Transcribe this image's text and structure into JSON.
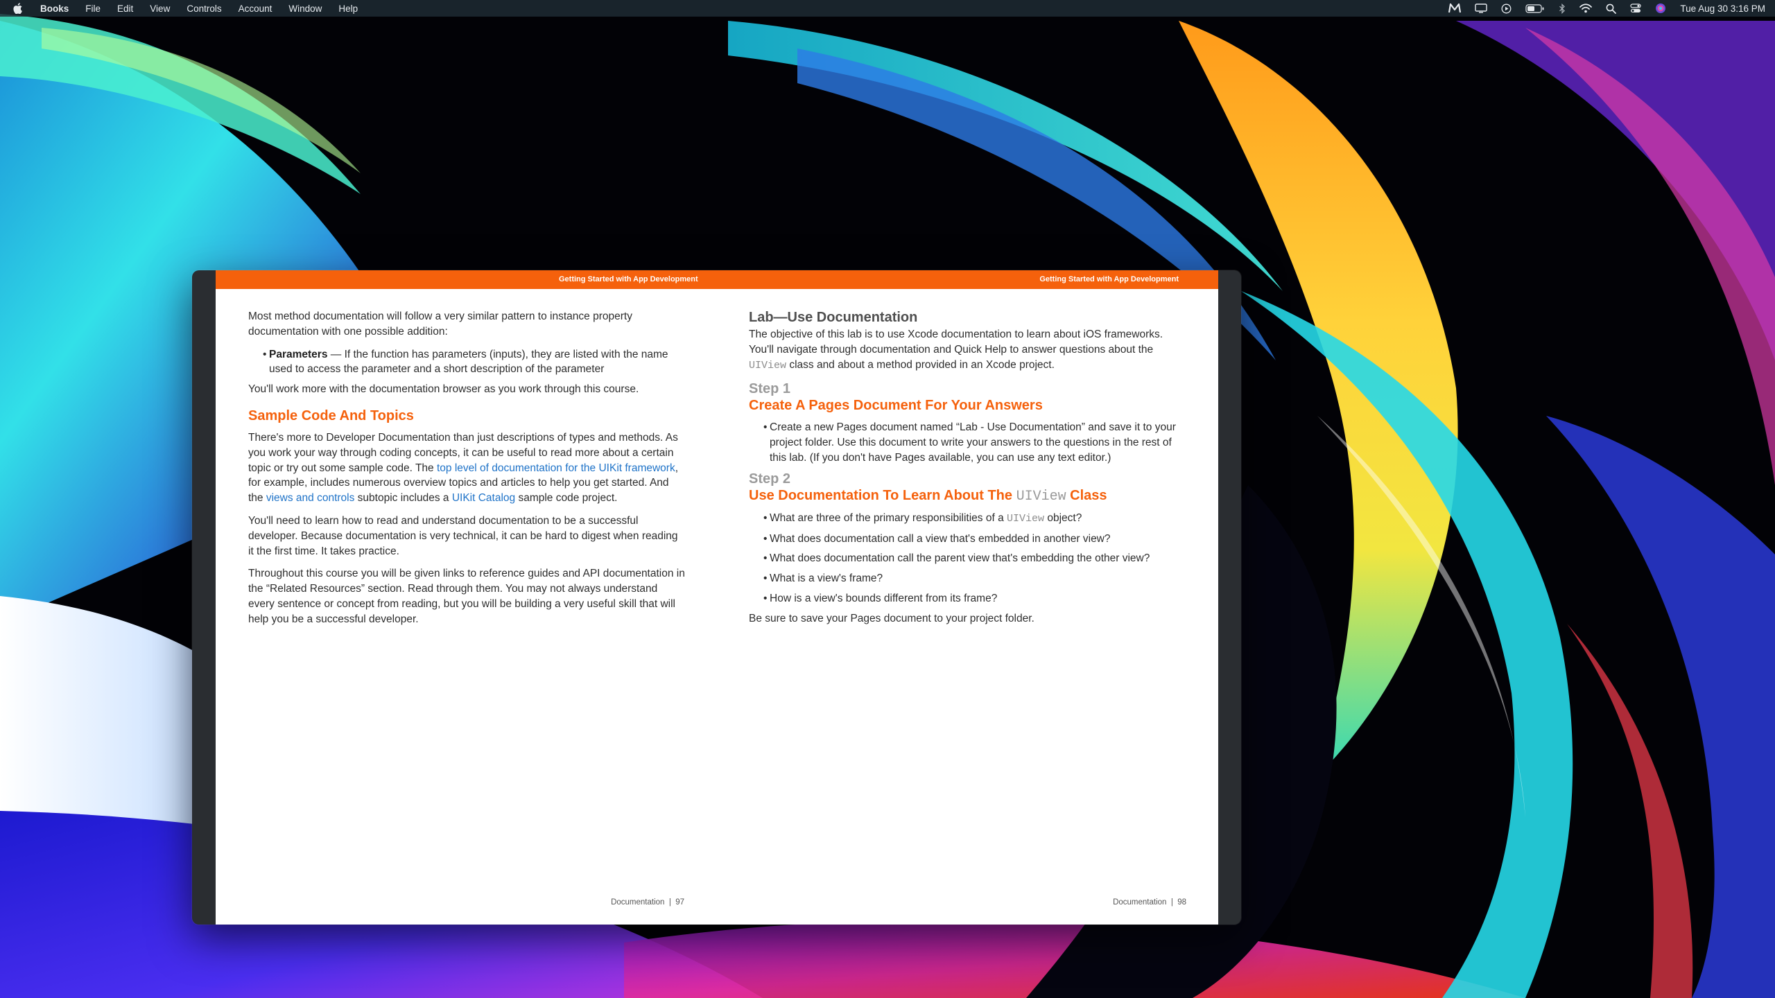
{
  "menubar": {
    "app_name": "Books",
    "menus": [
      "File",
      "Edit",
      "View",
      "Controls",
      "Account",
      "Window",
      "Help"
    ],
    "clock": "Tue Aug 30  3:16 PM",
    "status_icons": [
      "m-icon",
      "display-icon",
      "play-circle-icon",
      "battery-icon",
      "bluetooth-icon",
      "wifi-icon",
      "search-icon",
      "control-center-icon",
      "siri-icon"
    ]
  },
  "book": {
    "running_head": "Getting Started with App Development",
    "left_page": {
      "intro": "Most method documentation will follow a very similar pattern to instance property documentation with one possible addition:",
      "bullet_kw": "Parameters",
      "bullet_text": " — If the function has parameters (inputs), they are listed with the name used to access the parameter and a short description of the parameter",
      "work_more": "You'll work more with the documentation browser as you work through this course.",
      "heading": "Sample Code And Topics",
      "para1_a": "There's more to Developer Documentation than just descriptions of types and methods. As you work your way through coding concepts, it can be useful to read more about a certain topic or try out some sample code. The ",
      "link1": "top level of documentation for the UIKit framework",
      "para1_b": ", for example, includes numerous overview topics and articles to help you get started. And the ",
      "link2": "views and controls",
      "para1_c": " subtopic includes a ",
      "link3": "UIKit Catalog",
      "para1_d": " sample code project.",
      "para2": "You'll need to learn how to read and understand documentation to be a successful developer. Because documentation is very technical, it can be hard to digest when reading it the first time. It takes practice.",
      "para3": "Throughout this course you will be given links to reference guides and API documentation in the “Related Resources” section. Read through them. You may not always understand every sentence or concept from reading, but you will be building a very useful skill that will help you be a successful developer.",
      "footer_section": "Documentation",
      "footer_sep": "|",
      "page_number": "97"
    },
    "right_page": {
      "heading": "Lab—Use Documentation",
      "objective_a": "The objective of this lab is to use Xcode documentation to learn about iOS frameworks. You'll navigate through documentation and Quick Help to answer questions about the ",
      "objective_code": "UIView",
      "objective_b": " class and about a method provided in an Xcode project.",
      "step1_label": "Step 1",
      "step1_title": "Create A Pages Document For Your Answers",
      "step1_bullet": "Create a new Pages document named “Lab - Use Documentation” and save it to your project folder. Use this document to write your answers to the questions in the rest of this lab. (If you don't have Pages available, you can use any text editor.)",
      "step2_label": "Step 2",
      "step2_title_a": "Use Documentation To Learn About The ",
      "step2_title_code": "UIView",
      "step2_title_b": " Class",
      "q1_a": "What are three of the primary responsibilities of a ",
      "q1_code": "UIView",
      "q1_b": " object?",
      "q2": "What does documentation call a view that's embedded in another view?",
      "q3": "What does documentation call the parent view that's embedding the other view?",
      "q4": "What is a view's frame?",
      "q5": "How is a view's bounds different from its frame?",
      "closing": "Be sure to save your Pages document to your project folder.",
      "footer_section": "Documentation",
      "footer_sep": "|",
      "page_number": "98"
    }
  },
  "colors": {
    "accent": "#f5610c",
    "link": "#1f73c8",
    "menubar": "#1e2c34"
  }
}
